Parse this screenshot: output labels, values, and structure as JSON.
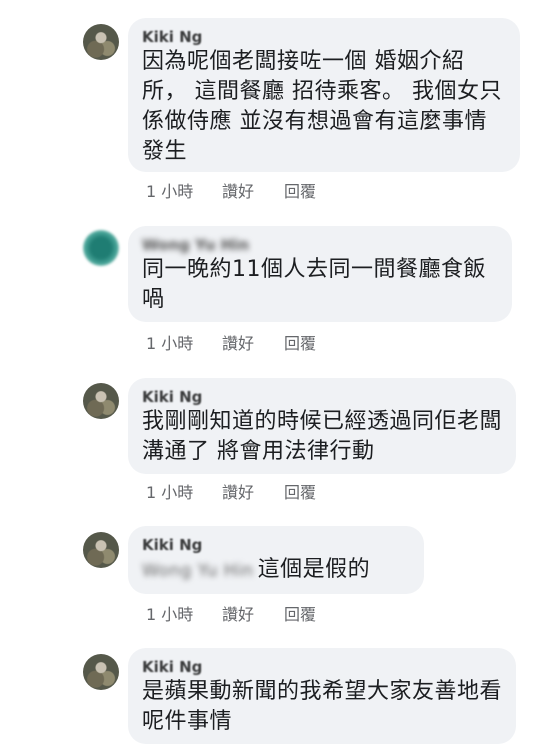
{
  "comments": [
    {
      "name": "Kiki Ng",
      "text": "因為呢個老闆接咗一個 婚姻介紹所， 這間餐廳 招待乘客。 我個女只係做侍應 並沒有想過會有這麼事情發生",
      "time": "1 小時",
      "like": "讚好",
      "reply": "回覆"
    },
    {
      "name": "Wong Yu Hin",
      "text": "同一晚約11個人去同一間餐廳食飯喎",
      "time": "1 小時",
      "like": "讚好",
      "reply": "回覆"
    },
    {
      "name": "Kiki Ng",
      "text": "我剛剛知道的時候已經透過同佢老闆溝通了 將會用法律行動",
      "time": "1 小時",
      "like": "讚好",
      "reply": "回覆"
    },
    {
      "name": "Kiki Ng",
      "mention": "Wong Yu Hin",
      "text": "這個是假的",
      "time": "1 小時",
      "like": "讚好",
      "reply": "回覆"
    },
    {
      "name": "Kiki Ng",
      "text": "是蘋果動新聞的我希望大家友善地看呢件事情"
    }
  ]
}
